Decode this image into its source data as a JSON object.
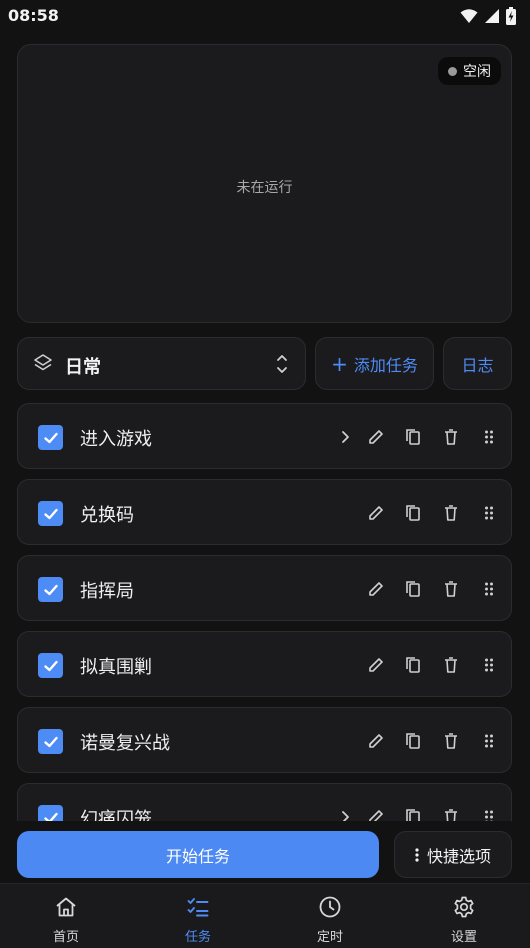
{
  "status_bar": {
    "time": "08:58"
  },
  "preview": {
    "status_badge": "空闲",
    "message": "未在运行"
  },
  "toolbar": {
    "group_label": "日常",
    "add_task_label": "添加任务",
    "log_label": "日志"
  },
  "tasks": [
    {
      "name": "进入游戏",
      "checked": true,
      "has_arrow": true
    },
    {
      "name": "兑换码",
      "checked": true,
      "has_arrow": false
    },
    {
      "name": "指挥局",
      "checked": true,
      "has_arrow": false
    },
    {
      "name": "拟真围剿",
      "checked": true,
      "has_arrow": false
    },
    {
      "name": "诺曼复兴战",
      "checked": true,
      "has_arrow": false
    },
    {
      "name": "幻痛囚笼",
      "checked": true,
      "has_arrow": true
    }
  ],
  "actions": {
    "start_label": "开始任务",
    "quick_options_label": "快捷选项"
  },
  "nav": {
    "items": [
      {
        "label": "首页",
        "icon": "home-icon",
        "active": false
      },
      {
        "label": "任务",
        "icon": "task-list-icon",
        "active": true
      },
      {
        "label": "定时",
        "icon": "clock-icon",
        "active": false
      },
      {
        "label": "设置",
        "icon": "gear-icon",
        "active": false
      }
    ]
  },
  "colors": {
    "accent": "#4e8cf5",
    "background": "#121212",
    "card": "#1b1b1d"
  }
}
